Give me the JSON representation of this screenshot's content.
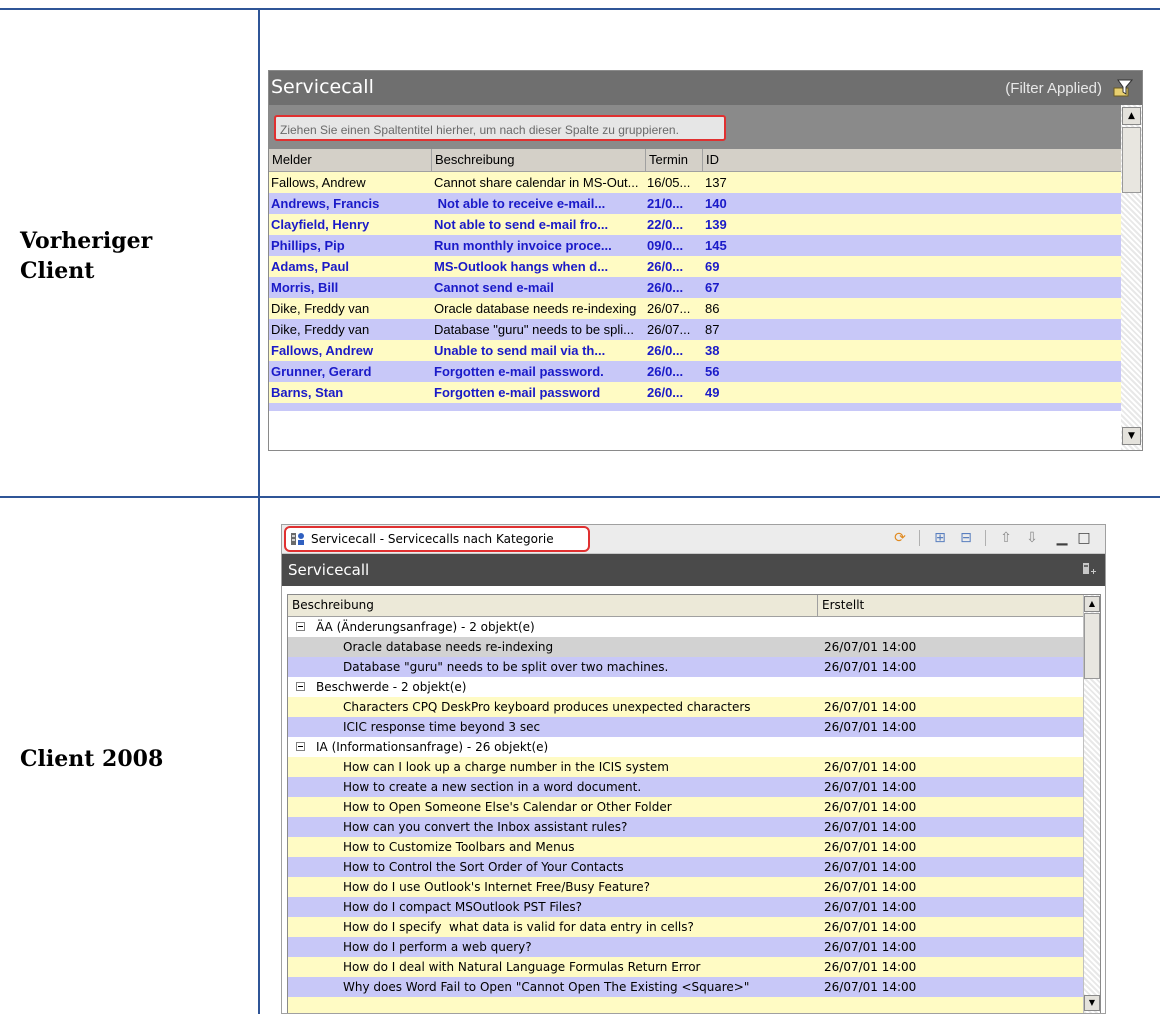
{
  "labels": {
    "old_client_line1": "Vorheriger",
    "old_client_line2": "Client",
    "new_client": "Client 2008"
  },
  "old_client": {
    "title": "Servicecall",
    "filter_status": "(Filter Applied)",
    "group_hint": "Ziehen Sie einen Spaltentitel hierher, um nach dieser Spalte zu gruppieren.",
    "columns": [
      "Melder",
      "Beschreibung",
      "Termin",
      "ID"
    ],
    "rows": [
      {
        "melder": "Fallows, Andrew",
        "beschreibung": "Cannot share calendar in MS-Out...",
        "termin": "16/05...",
        "id": "137"
      },
      {
        "melder": "Andrews, Francis",
        "beschreibung": " Not able to receive e-mail...",
        "termin": "21/0...",
        "id": "140"
      },
      {
        "melder": "Clayfield, Henry",
        "beschreibung": "Not able to send e-mail fro...",
        "termin": "22/0...",
        "id": "139"
      },
      {
        "melder": "Phillips, Pip",
        "beschreibung": "Run monthly invoice proce...",
        "termin": "09/0...",
        "id": "145"
      },
      {
        "melder": "Adams, Paul",
        "beschreibung": "MS-Outlook hangs when d...",
        "termin": "26/0...",
        "id": "69"
      },
      {
        "melder": "Morris, Bill",
        "beschreibung": "Cannot send e-mail",
        "termin": "26/0...",
        "id": "67"
      },
      {
        "melder": "Dike, Freddy van",
        "beschreibung": "Oracle database needs re-indexing",
        "termin": "26/07...",
        "id": "86"
      },
      {
        "melder": "Dike, Freddy van",
        "beschreibung": "Database \"guru\" needs to be spli...",
        "termin": "26/07...",
        "id": "87"
      },
      {
        "melder": "Fallows, Andrew",
        "beschreibung": "Unable to send mail via th...",
        "termin": "26/0...",
        "id": "38"
      },
      {
        "melder": "Grunner, Gerard",
        "beschreibung": "Forgotten e-mail password.",
        "termin": "26/0...",
        "id": "56"
      },
      {
        "melder": "Barns, Stan",
        "beschreibung": "Forgotten e-mail password",
        "termin": "26/0...",
        "id": "49"
      }
    ]
  },
  "new_client": {
    "tab_title": "Servicecall - Servicecalls nach Kategorie",
    "view_title": "Servicecall",
    "columns": [
      "Beschreibung",
      "Erstellt"
    ],
    "groups": [
      {
        "label": "ÄA (Änderungsanfrage) - 2 objekt(e)",
        "items": [
          {
            "desc": "Oracle database needs re-indexing",
            "date": "26/07/01 14:00"
          },
          {
            "desc": "Database \"guru\" needs to be split over two machines.",
            "date": "26/07/01 14:00"
          }
        ]
      },
      {
        "label": "Beschwerde - 2 objekt(e)",
        "items": [
          {
            "desc": "Characters CPQ DeskPro keyboard produces unexpected characters",
            "date": "26/07/01 14:00"
          },
          {
            "desc": "ICIC response time beyond 3 sec",
            "date": "26/07/01 14:00"
          }
        ]
      },
      {
        "label": "IA (Informationsanfrage) - 26 objekt(e)",
        "items": [
          {
            "desc": "How can I look up a charge number in the ICIS system",
            "date": "26/07/01 14:00"
          },
          {
            "desc": "How to create a new section in a word document.",
            "date": "26/07/01 14:00"
          },
          {
            "desc": "How to Open Someone Else's Calendar or Other Folder",
            "date": "26/07/01 14:00"
          },
          {
            "desc": "How can you convert the Inbox assistant rules?",
            "date": "26/07/01 14:00"
          },
          {
            "desc": "How to Customize Toolbars and Menus",
            "date": "26/07/01 14:00"
          },
          {
            "desc": "How to Control the Sort Order of Your Contacts",
            "date": "26/07/01 14:00"
          },
          {
            "desc": "How do I use Outlook's Internet Free/Busy Feature?",
            "date": "26/07/01 14:00"
          },
          {
            "desc": "How do I compact MSOutlook PST Files?",
            "date": "26/07/01 14:00"
          },
          {
            "desc": "How do I specify  what data is valid for data entry in cells?",
            "date": "26/07/01 14:00"
          },
          {
            "desc": "How do I perform a web query?",
            "date": "26/07/01 14:00"
          },
          {
            "desc": "How do I deal with Natural Language Formulas Return Error",
            "date": "26/07/01 14:00"
          },
          {
            "desc": "Why does Word Fail to Open \"Cannot Open The Existing <Square>\"",
            "date": "26/07/01 14:00"
          }
        ]
      }
    ]
  }
}
